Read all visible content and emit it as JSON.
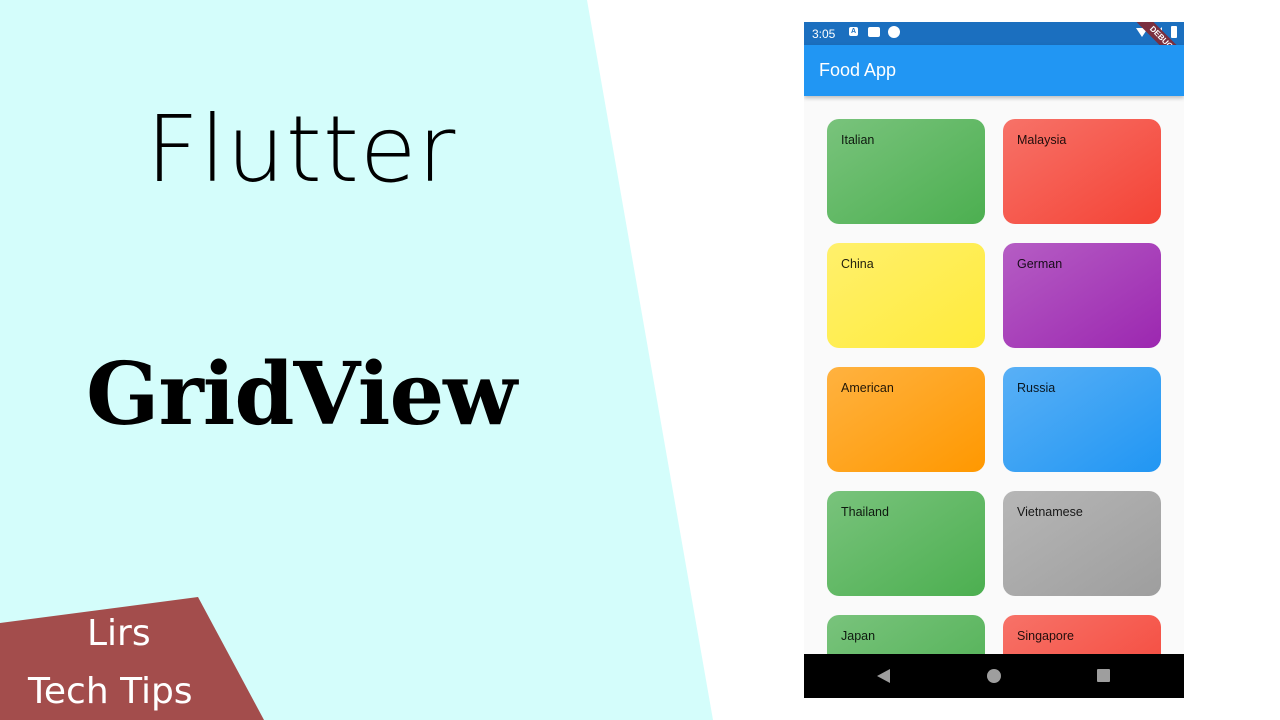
{
  "thumbnail": {
    "title_line1": "Flutter",
    "title_line2": "GridView",
    "brand_line1": "Lirs",
    "brand_line2": "Tech Tips",
    "background_color": "#d4fdfb",
    "brand_color": "#a34d4c"
  },
  "phone": {
    "status_bar": {
      "time": "3:05",
      "notification_icons": [
        "accessibility-a-icon",
        "message-icon",
        "app-f-icon"
      ],
      "system_icons": [
        "wifi-icon",
        "signal-icon",
        "battery-icon"
      ],
      "debug_banner": "DEBUG"
    },
    "app_bar": {
      "title": "Food App",
      "color": "#2196f3"
    },
    "grid": {
      "items": [
        {
          "label": "Italian",
          "color": "#4caf50"
        },
        {
          "label": "Malaysia",
          "color": "#f44336"
        },
        {
          "label": "China",
          "color": "#ffeb3b"
        },
        {
          "label": "German",
          "color": "#9c27b0"
        },
        {
          "label": "American",
          "color": "#ff9800"
        },
        {
          "label": "Russia",
          "color": "#2196f3"
        },
        {
          "label": "Thailand",
          "color": "#4caf50"
        },
        {
          "label": "Vietnamese",
          "color": "#9e9e9e"
        },
        {
          "label": "Japan",
          "color": "#4caf50"
        },
        {
          "label": "Singapore",
          "color": "#f44336"
        }
      ]
    },
    "nav_bar": {
      "buttons": [
        "back-icon",
        "home-icon",
        "recent-apps-icon"
      ]
    }
  }
}
